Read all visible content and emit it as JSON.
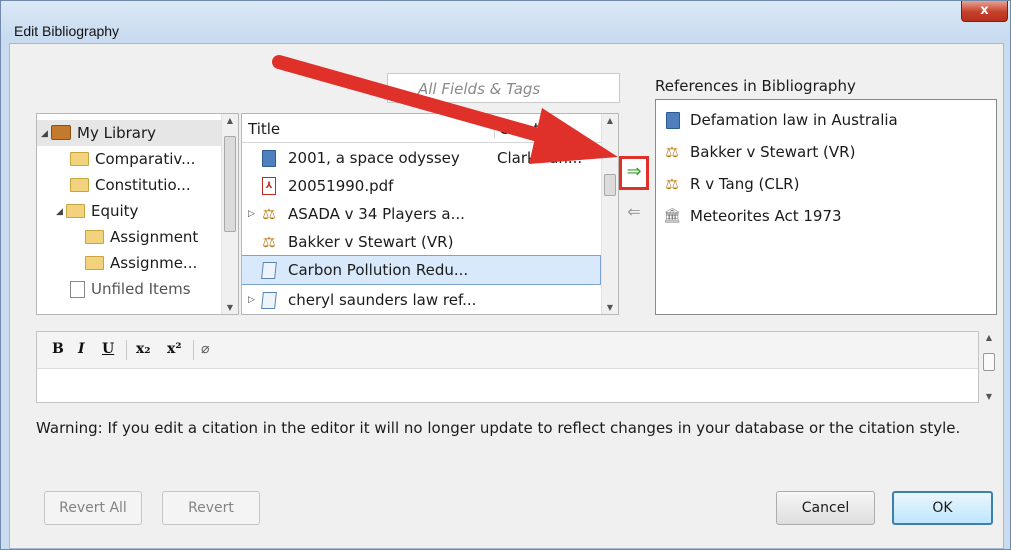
{
  "window": {
    "title": "Edit Bibliography",
    "close_glyph": "x"
  },
  "search": {
    "placeholder": "All Fields & Tags"
  },
  "references_label": "References in Bibliography",
  "library_tree": {
    "items": [
      {
        "label": "My Library",
        "icon": "library-icon",
        "expanded": true
      },
      {
        "label": "Comparativ...",
        "icon": "folder-icon"
      },
      {
        "label": "Constitutio...",
        "icon": "folder-icon"
      },
      {
        "label": "Equity",
        "icon": "folder-icon",
        "expanded": true
      },
      {
        "label": "Assignment",
        "icon": "folder-icon"
      },
      {
        "label": "Assignme...",
        "icon": "folder-icon"
      },
      {
        "label": "Unfiled Items",
        "icon": "unfiled-items-icon"
      }
    ]
  },
  "items_list": {
    "columns": {
      "title": "Title",
      "creator": "Creator"
    },
    "rows": [
      {
        "title": "2001, a space odyssey",
        "creator": "Clarke an...",
        "icon": "book-icon"
      },
      {
        "title": "20051990.pdf",
        "creator": "",
        "icon": "pdf-icon"
      },
      {
        "title": "ASADA v 34 Players a...",
        "creator": "",
        "icon": "case-icon"
      },
      {
        "title": "Bakker v Stewart (VR)",
        "creator": "",
        "icon": "case-icon"
      },
      {
        "title": "Carbon Pollution Redu...",
        "creator": "",
        "icon": "bill-icon",
        "selected": true
      },
      {
        "title": "cheryl saunders law ref...",
        "creator": "",
        "icon": "document-icon"
      }
    ]
  },
  "transfer": {
    "add_glyph": "⇒",
    "remove_glyph": "⇐"
  },
  "references": [
    {
      "label": "Defamation law in Australia",
      "icon": "book-icon"
    },
    {
      "label": "Bakker v Stewart (VR)",
      "icon": "case-icon"
    },
    {
      "label": "R v Tang (CLR)",
      "icon": "case-icon"
    },
    {
      "label": "Meteorites Act 1973",
      "icon": "statute-icon"
    }
  ],
  "editor_toolbar": {
    "bold": "B",
    "italic": "I",
    "underline": "U",
    "subscript": "x₂",
    "superscript": "x²",
    "clear_formatting_glyph": "⌀"
  },
  "warning": "Warning: If you edit a citation in the editor it will no longer update to reflect changes in your database or the citation style.",
  "buttons": {
    "revert_all": "Revert All",
    "revert": "Revert",
    "cancel": "Cancel",
    "ok": "OK"
  },
  "colors": {
    "annotation_arrow": "#e0302a",
    "add_arrow": "#3aa02e"
  }
}
